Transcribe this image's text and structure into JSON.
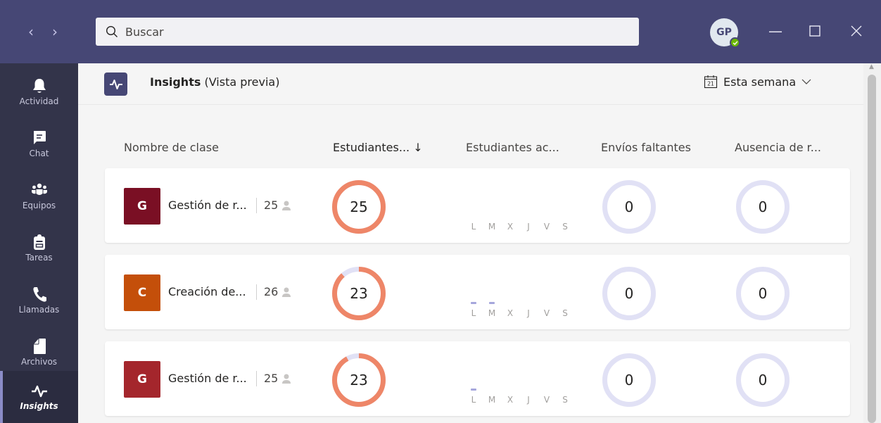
{
  "titlebar": {
    "search_placeholder": "Buscar",
    "avatar_initials": "GP",
    "presence": "available"
  },
  "rail": [
    {
      "label": "Actividad",
      "icon": "bell-icon"
    },
    {
      "label": "Chat",
      "icon": "chat-icon"
    },
    {
      "label": "Equipos",
      "icon": "teams-icon"
    },
    {
      "label": "Tareas",
      "icon": "assignments-icon"
    },
    {
      "label": "Llamadas",
      "icon": "phone-icon"
    },
    {
      "label": "Archivos",
      "icon": "file-icon"
    },
    {
      "label": "Insights",
      "icon": "pulse-icon",
      "active": true
    }
  ],
  "header": {
    "title": "Insights",
    "subtitle": "(Vista previa)",
    "calendar_day": "21",
    "period": "Esta semana"
  },
  "columns": [
    "Nombre de clase",
    "Estudiantes... ↓",
    "Estudiantes ac...",
    "Envíos faltantes",
    "Ausencia de r..."
  ],
  "day_labels": [
    "L",
    "M",
    "X",
    "J",
    "V",
    "S"
  ],
  "rows": [
    {
      "initial": "G",
      "color": "#7a0f24",
      "name": "Gestión de r...",
      "members": "25",
      "students": "25",
      "students_fraction": 1.0,
      "activity_days": [],
      "missing": "0",
      "absence": "0"
    },
    {
      "initial": "C",
      "color": "#c44f0a",
      "name": "Creación de...",
      "members": "26",
      "students": "23",
      "students_fraction": 0.885,
      "activity_days": [
        0,
        1
      ],
      "missing": "0",
      "absence": "0"
    },
    {
      "initial": "G",
      "color": "#a4262c",
      "name": "Gestión de r...",
      "members": "25",
      "students": "23",
      "students_fraction": 0.92,
      "activity_days": [
        0
      ],
      "missing": "0",
      "absence": "0"
    }
  ],
  "colors": {
    "titlebar": "#464775",
    "rail": "#33344a",
    "ring_fill": "#ee8668",
    "ring_track": "#e1e1f5",
    "activity_mark": "#a6a7dc"
  }
}
